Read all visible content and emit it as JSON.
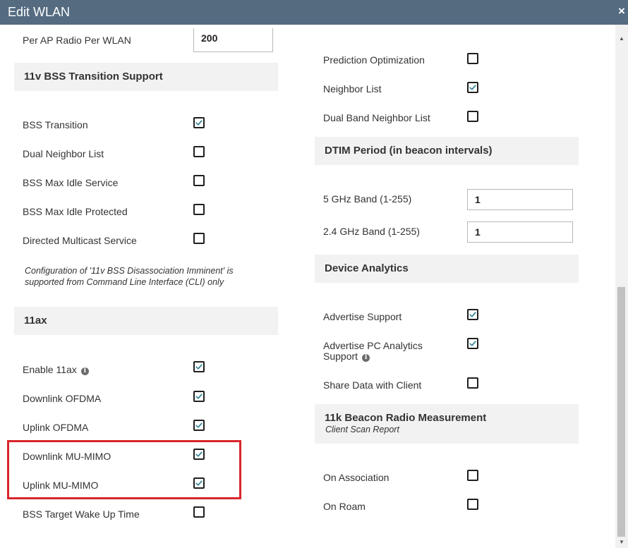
{
  "window": {
    "title": "Edit WLAN",
    "close_glyph": "×"
  },
  "left": {
    "per_ap": {
      "label": "Per AP Radio Per WLAN",
      "value": "200"
    },
    "bss_section": {
      "title": "11v BSS Transition Support"
    },
    "bss_items": [
      {
        "label": "BSS Transition",
        "checked": true
      },
      {
        "label": "Dual Neighbor List",
        "checked": false
      },
      {
        "label": "BSS Max Idle Service",
        "checked": false
      },
      {
        "label": "BSS Max Idle Protected",
        "checked": false
      },
      {
        "label": "Directed Multicast Service",
        "checked": false
      }
    ],
    "note_line1": "Configuration of '11v BSS Disassociation Imminent' is",
    "note_line2": "supported from Command Line Interface (CLI) only",
    "ax_section": {
      "title": "11ax"
    },
    "ax_items": [
      {
        "label": "Enable 11ax",
        "checked": true,
        "info": true
      },
      {
        "label": "Downlink OFDMA",
        "checked": true
      },
      {
        "label": "Uplink OFDMA",
        "checked": true
      },
      {
        "label": "Downlink MU-MIMO",
        "checked": true
      },
      {
        "label": "Uplink MU-MIMO",
        "checked": true
      },
      {
        "label": "BSS Target Wake Up Time",
        "checked": false
      }
    ]
  },
  "right": {
    "top_items": [
      {
        "label": "Prediction Optimization",
        "checked": false
      },
      {
        "label": "Neighbor List",
        "checked": true
      },
      {
        "label": "Dual Band Neighbor List",
        "checked": false
      }
    ],
    "dtim_section": {
      "title": "DTIM Period (in beacon intervals)"
    },
    "dtim_5": {
      "label": "5 GHz Band (1-255)",
      "value": "1"
    },
    "dtim_24": {
      "label": "2.4 GHz Band (1-255)",
      "value": "1"
    },
    "analytics_section": {
      "title": "Device Analytics"
    },
    "advertise_support": {
      "label": "Advertise Support",
      "checked": true
    },
    "advertise_pc": {
      "label_line1": "Advertise PC Analytics",
      "label_line2": "Support",
      "checked": true,
      "info": true
    },
    "share_data": {
      "label": "Share Data with Client",
      "checked": false
    },
    "k_section": {
      "title": "11k Beacon Radio Measurement",
      "subtitle": "Client Scan Report"
    },
    "k_items": [
      {
        "label": "On Association",
        "checked": false
      },
      {
        "label": "On Roam",
        "checked": false
      }
    ]
  },
  "scrollbar": {
    "up_glyph": "▲",
    "down_glyph": "▼"
  }
}
